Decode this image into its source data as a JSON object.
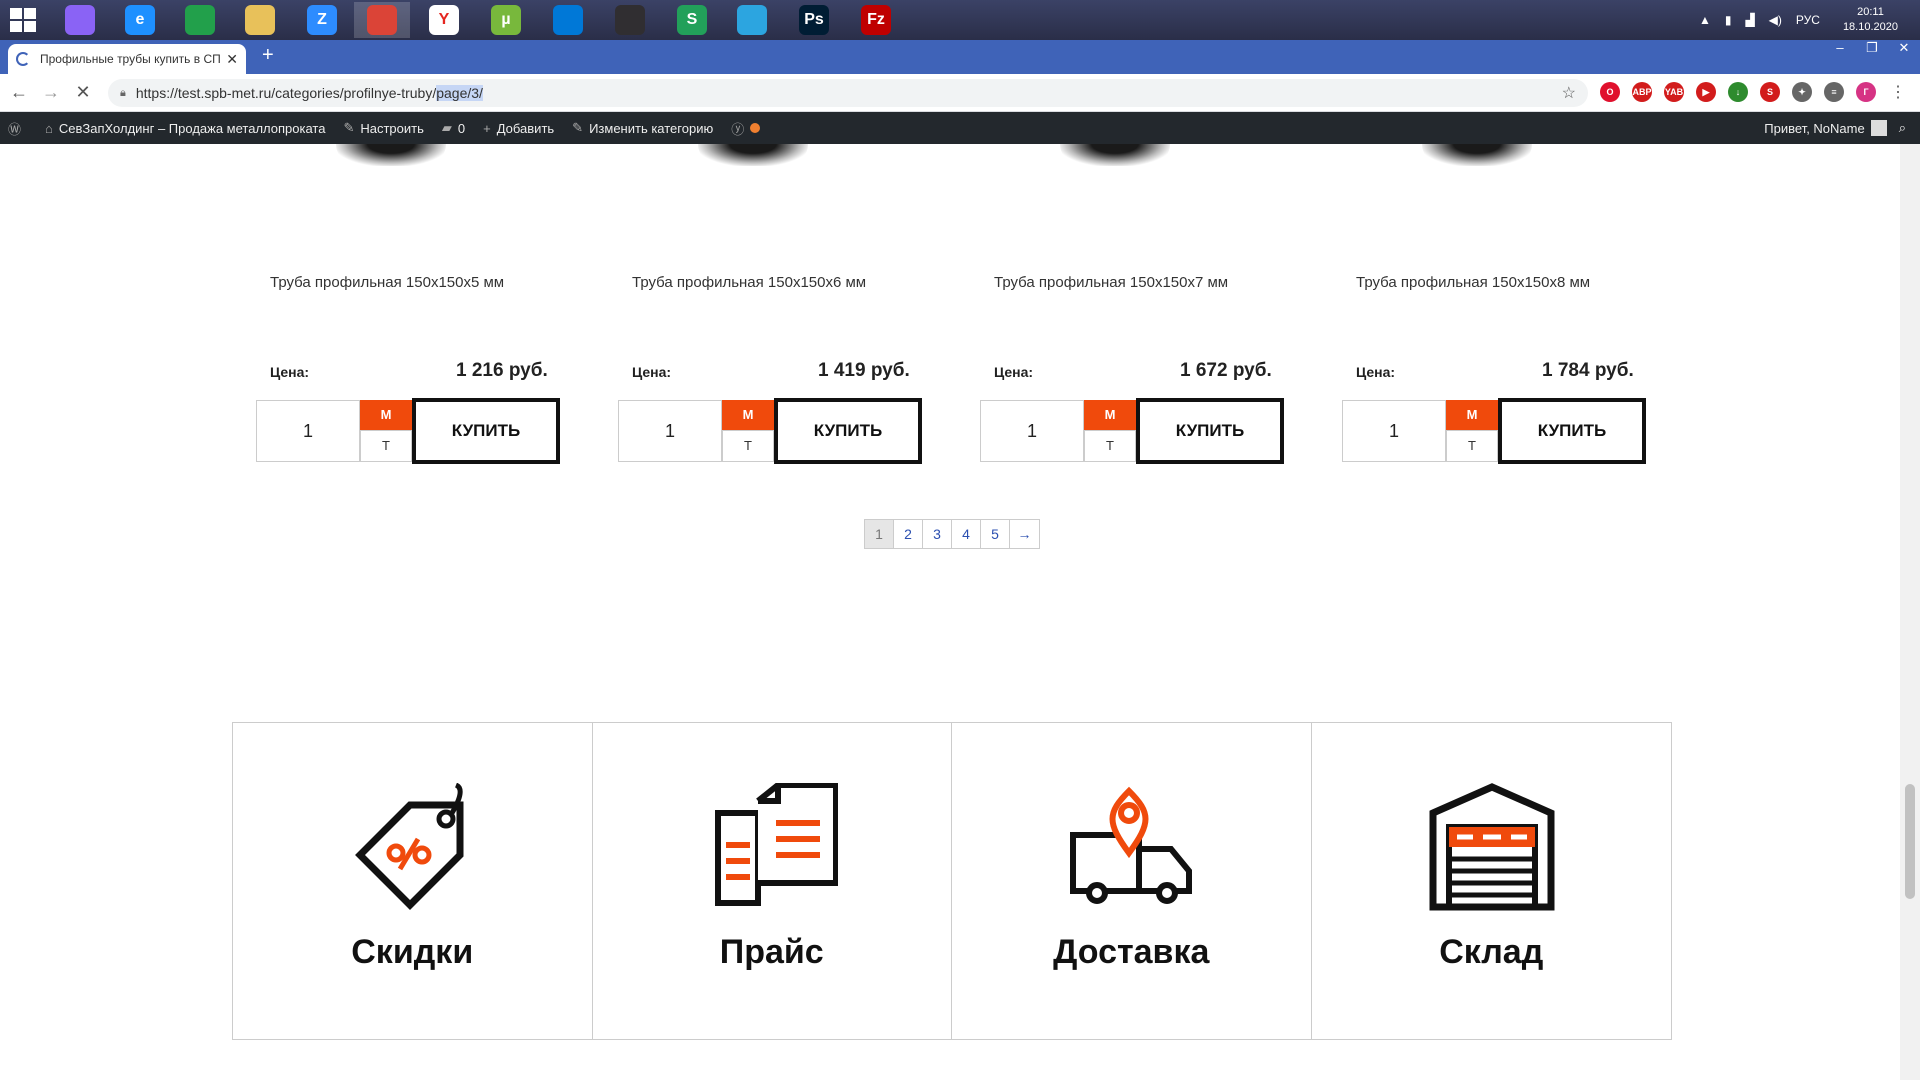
{
  "taskbar": {
    "apps": [
      {
        "icon": "cortana-icon",
        "label": "",
        "color": "#8a63f5"
      },
      {
        "icon": "internet-explorer-icon",
        "label": "e",
        "color": "#1e90ff"
      },
      {
        "icon": "store-icon",
        "label": "",
        "color": "#22a04b"
      },
      {
        "icon": "file-explorer-icon",
        "label": "",
        "color": "#e8c15a"
      },
      {
        "icon": "zoom-icon",
        "label": "Z",
        "color": "#2d8cff"
      },
      {
        "icon": "chrome-icon",
        "label": "",
        "color": "#db4437"
      },
      {
        "icon": "yandex-browser-icon",
        "label": "Y",
        "color": "#ffffff"
      },
      {
        "icon": "utorrent-icon",
        "label": "µ",
        "color": "#78b83c"
      },
      {
        "icon": "vscode-icon",
        "label": "",
        "color": "#0078d7"
      },
      {
        "icon": "obs-icon",
        "label": "",
        "color": "#302e31"
      },
      {
        "icon": "skype-icon",
        "label": "S",
        "color": "#22a05a"
      },
      {
        "icon": "telegram-icon",
        "label": "",
        "color": "#2ca5e0"
      },
      {
        "icon": "photoshop-icon",
        "label": "Ps",
        "color": "#001d34"
      },
      {
        "icon": "filezilla-icon",
        "label": "Fz",
        "color": "#bf0000"
      }
    ],
    "tray": {
      "language": "РУС",
      "time": "20:11",
      "date": "18.10.2020"
    }
  },
  "browser": {
    "tab_title": "Профильные трубы купить в СПб",
    "url_base": "https://test.spb-met.ru/categories/profilnye-truby/",
    "url_selected": "page/3/",
    "extensions": [
      {
        "icon": "opera-icon",
        "color": "#e0102d",
        "label": "O"
      },
      {
        "icon": "adblock-icon",
        "color": "#d21c1c",
        "label": "ABP"
      },
      {
        "icon": "yandex-icon",
        "color": "#d21c1c",
        "label": "YAB"
      },
      {
        "icon": "video-icon",
        "color": "#d21c1c",
        "label": "▶"
      },
      {
        "icon": "download-icon",
        "color": "#2e8b2e",
        "label": "↓"
      },
      {
        "icon": "sync-icon",
        "color": "#d21c1c",
        "label": "S"
      },
      {
        "icon": "puzzle-icon",
        "color": "#666666",
        "label": "✦"
      },
      {
        "icon": "playlist-icon",
        "color": "#666666",
        "label": "≡"
      },
      {
        "icon": "profile-icon",
        "color": "#d63384",
        "label": "Г"
      }
    ]
  },
  "adminbar": {
    "site_name": "СевЗапХолдинг – Продажа металлопроката",
    "customize": "Настроить",
    "comments": "0",
    "add_new": "Добавить",
    "edit_category": "Изменить категорию",
    "greeting": "Привет, NoName"
  },
  "products": [
    {
      "title": "Труба профильная 150х150х5 мм",
      "price_label": "Цена:",
      "price": "1 216 руб.",
      "qty": "1",
      "unit_m": "М",
      "unit_t": "Т",
      "buy": "КУПИТЬ"
    },
    {
      "title": "Труба профильная 150х150х6 мм",
      "price_label": "Цена:",
      "price": "1 419 руб.",
      "qty": "1",
      "unit_m": "М",
      "unit_t": "Т",
      "buy": "КУПИТЬ"
    },
    {
      "title": "Труба профильная 150х150х7 мм",
      "price_label": "Цена:",
      "price": "1 672 руб.",
      "qty": "1",
      "unit_m": "М",
      "unit_t": "Т",
      "buy": "КУПИТЬ"
    },
    {
      "title": "Труба профильная 150х150х8 мм",
      "price_label": "Цена:",
      "price": "1 784 руб.",
      "qty": "1",
      "unit_m": "М",
      "unit_t": "Т",
      "buy": "КУПИТЬ"
    }
  ],
  "pagination": {
    "pages": [
      "1",
      "2",
      "3",
      "4",
      "5"
    ],
    "current": "1",
    "next": "→"
  },
  "features": [
    {
      "label": "Скидки",
      "icon": "discount-tag-icon"
    },
    {
      "label": "Прайс",
      "icon": "price-list-icon"
    },
    {
      "label": "Доставка",
      "icon": "delivery-truck-icon"
    },
    {
      "label": "Склад",
      "icon": "warehouse-icon"
    }
  ],
  "colors": {
    "accent": "#f04a0c",
    "admin_bar": "#23282d",
    "tab_strip": "#3f63b8"
  }
}
